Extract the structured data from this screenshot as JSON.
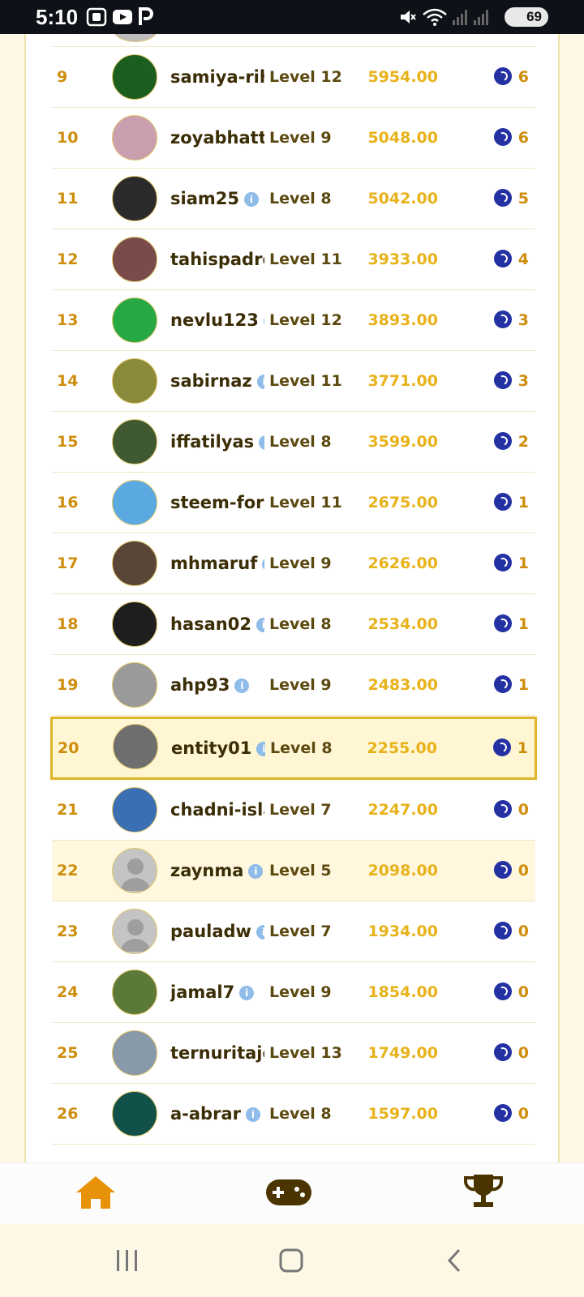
{
  "status_bar": {
    "time": "5:10",
    "battery": "69"
  },
  "leaderboard": {
    "rows": [
      {
        "rank": "9",
        "name": "samiya-rih",
        "info": false,
        "level": "Level 12",
        "points": "5954.00",
        "reward": "6",
        "avatar_color": "#1b5e20",
        "alt": false,
        "current": false
      },
      {
        "rank": "10",
        "name": "zoyabhatti",
        "info": false,
        "level": "Level 9",
        "points": "5048.00",
        "reward": "6",
        "avatar_color": "#c99fb0",
        "alt": false,
        "current": false
      },
      {
        "rank": "11",
        "name": "siam25",
        "info": true,
        "level": "Level 8",
        "points": "5042.00",
        "reward": "5",
        "avatar_color": "#2b2b2b",
        "alt": false,
        "current": false
      },
      {
        "rank": "12",
        "name": "tahispadro",
        "info": false,
        "level": "Level 11",
        "points": "3933.00",
        "reward": "4",
        "avatar_color": "#7a4b4b",
        "alt": false,
        "current": false
      },
      {
        "rank": "13",
        "name": "nevlu123",
        "info": true,
        "level": "Level 12",
        "points": "3893.00",
        "reward": "3",
        "avatar_color": "#26a844",
        "alt": false,
        "current": false
      },
      {
        "rank": "14",
        "name": "sabirnaz",
        "info": true,
        "level": "Level 11",
        "points": "3771.00",
        "reward": "3",
        "avatar_color": "#8a8a3a",
        "alt": false,
        "current": false
      },
      {
        "rank": "15",
        "name": "iffatilyas",
        "info": true,
        "level": "Level 8",
        "points": "3599.00",
        "reward": "2",
        "avatar_color": "#3f5a33",
        "alt": false,
        "current": false
      },
      {
        "rank": "16",
        "name": "steem-for-",
        "info": false,
        "level": "Level 11",
        "points": "2675.00",
        "reward": "1",
        "avatar_color": "#5aa9e0",
        "alt": false,
        "current": false
      },
      {
        "rank": "17",
        "name": "mhmaruf",
        "info": true,
        "level": "Level 9",
        "points": "2626.00",
        "reward": "1",
        "avatar_color": "#5a4636",
        "alt": false,
        "current": false
      },
      {
        "rank": "18",
        "name": "hasan02",
        "info": true,
        "level": "Level 8",
        "points": "2534.00",
        "reward": "1",
        "avatar_color": "#1e1e1e",
        "alt": false,
        "current": false
      },
      {
        "rank": "19",
        "name": "ahp93",
        "info": true,
        "level": "Level 9",
        "points": "2483.00",
        "reward": "1",
        "avatar_color": "#9a9a9a",
        "alt": false,
        "current": false
      },
      {
        "rank": "20",
        "name": "entity01",
        "info": true,
        "level": "Level 8",
        "points": "2255.00",
        "reward": "1",
        "avatar_color": "#6e6e6e",
        "alt": false,
        "current": true
      },
      {
        "rank": "21",
        "name": "chadni-isla",
        "info": false,
        "level": "Level 7",
        "points": "2247.00",
        "reward": "0",
        "avatar_color": "#3b6fb3",
        "alt": false,
        "current": false
      },
      {
        "rank": "22",
        "name": "zaynma",
        "info": true,
        "level": "Level 5",
        "points": "2098.00",
        "reward": "0",
        "avatar_color": "#c4c4c4",
        "alt": true,
        "current": false
      },
      {
        "rank": "23",
        "name": "pauladw",
        "info": true,
        "level": "Level 7",
        "points": "1934.00",
        "reward": "0",
        "avatar_color": "#c4c4c4",
        "alt": false,
        "current": false
      },
      {
        "rank": "24",
        "name": "jamal7",
        "info": true,
        "level": "Level 9",
        "points": "1854.00",
        "reward": "0",
        "avatar_color": "#5b7a3a",
        "alt": false,
        "current": false
      },
      {
        "rank": "25",
        "name": "ternuritaje",
        "info": false,
        "level": "Level 13",
        "points": "1749.00",
        "reward": "0",
        "avatar_color": "#8899aa",
        "alt": false,
        "current": false
      },
      {
        "rank": "26",
        "name": "a-abrar",
        "info": true,
        "level": "Level 8",
        "points": "1597.00",
        "reward": "0",
        "avatar_color": "#12504a",
        "alt": false,
        "current": false
      }
    ]
  },
  "tab_bar": {
    "tabs": [
      {
        "name": "home",
        "icon": "home-icon",
        "color": "#e8920a"
      },
      {
        "name": "games",
        "icon": "gamepad-icon",
        "color": "#4a3500"
      },
      {
        "name": "leaderboard",
        "icon": "trophy-icon",
        "color": "#4a3500"
      }
    ]
  },
  "colors": {
    "rank": "#cf8d0c",
    "points": "#e8b21a",
    "name": "#3b2d05",
    "highlight_border": "#e0b52a",
    "coin": "#2431a3"
  }
}
